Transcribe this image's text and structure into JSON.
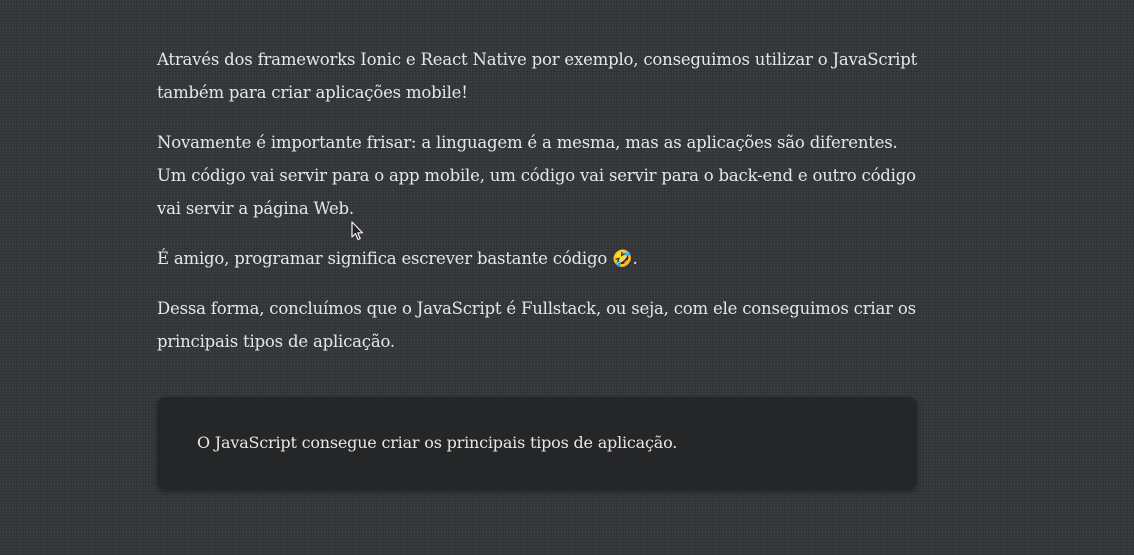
{
  "article": {
    "paragraphs": [
      "Através dos frameworks Ionic e React Native por exemplo, conseguimos utilizar o JavaScript também para criar aplicações mobile!",
      "Novamente é importante frisar: a linguagem é a mesma, mas as aplicações são diferentes. Um código vai servir para o app mobile, um código vai servir para o back-end e outro código vai servir a página Web.",
      "É amigo, programar significa escrever bastante código ",
      "Dessa forma, concluímos que o JavaScript é Fullstack, ou seja, com ele conseguimos criar os principais tipos de aplicação."
    ],
    "emoji": "🤣",
    "emoji_suffix": "."
  },
  "callout": {
    "text": "O JavaScript consegue criar os principais tipos de aplicação."
  },
  "icons": {
    "cursor": "mouse-pointer-icon",
    "emoji": "rolling-on-floor-laughing-emoji"
  }
}
